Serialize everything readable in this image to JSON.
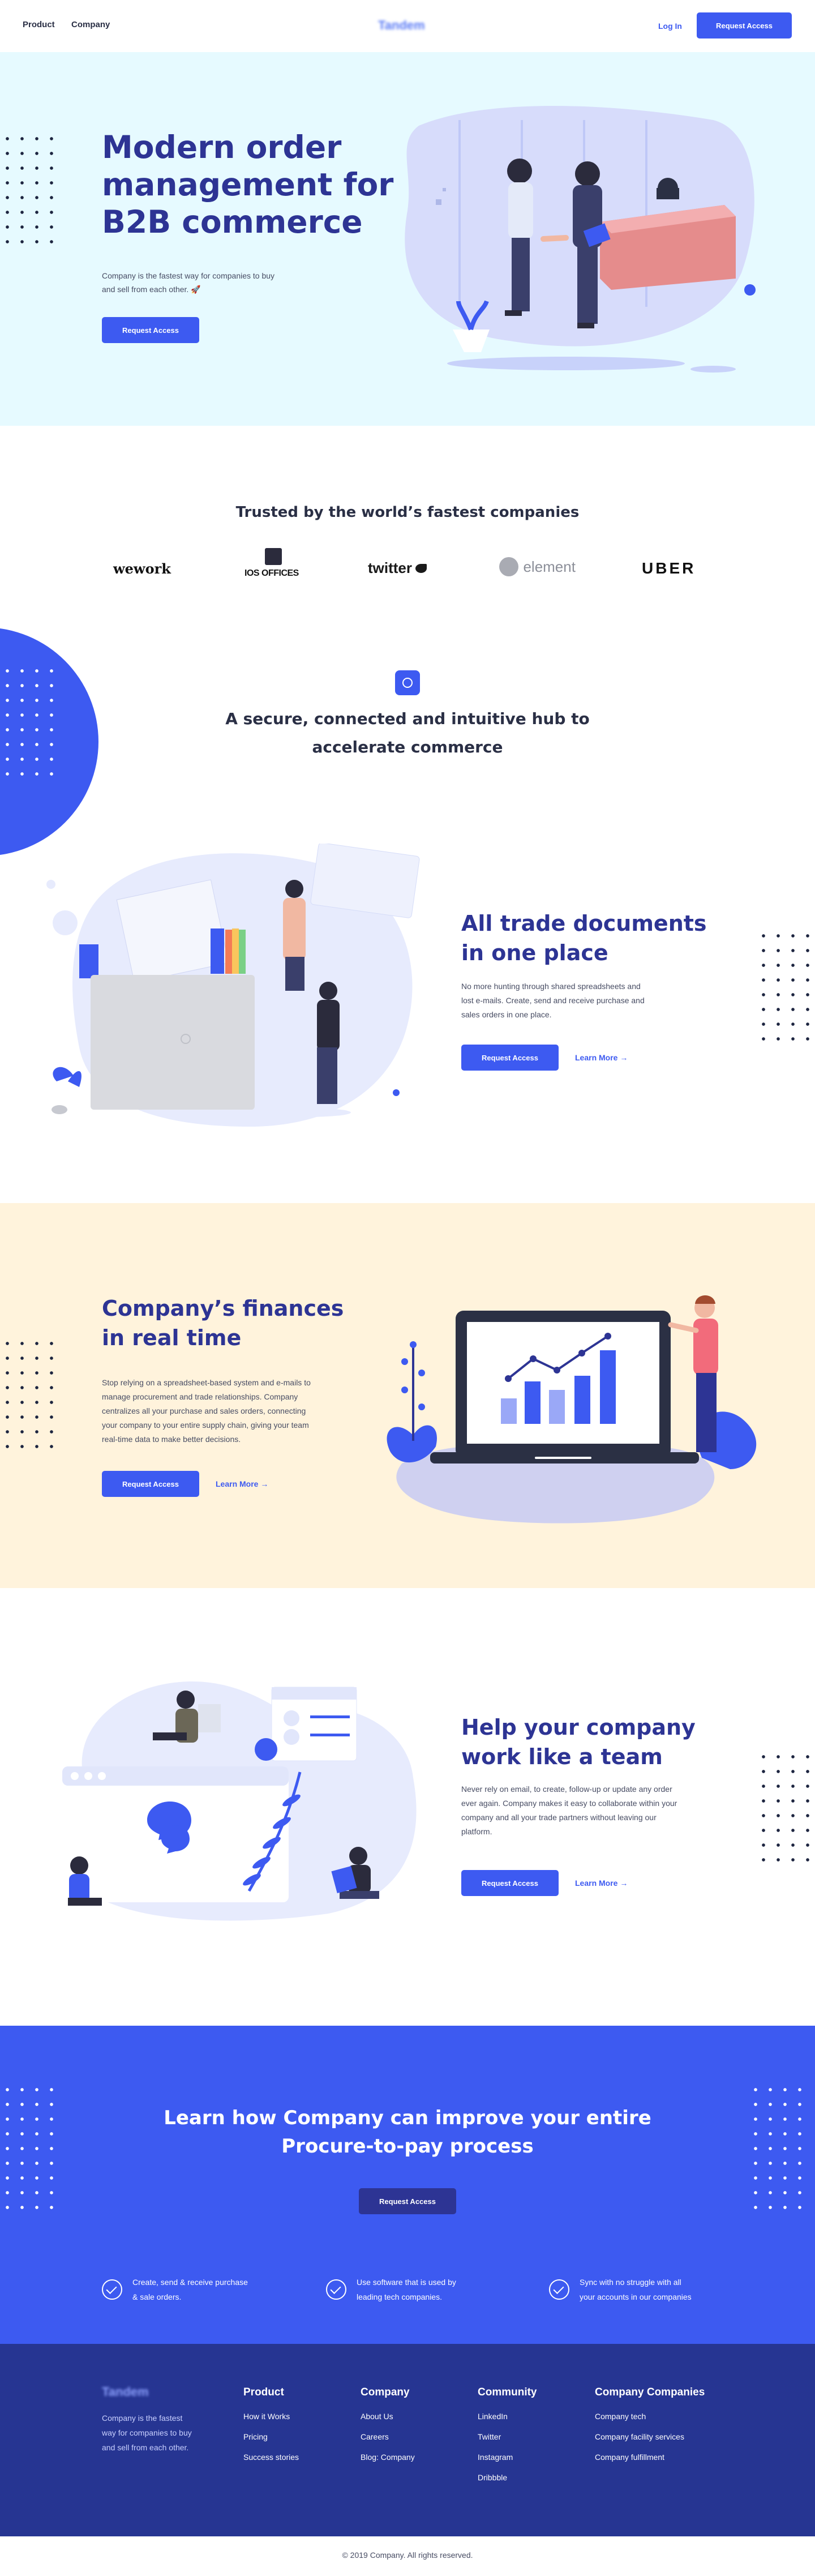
{
  "nav": {
    "items": [
      "Product",
      "Company"
    ],
    "logo": "Tandem",
    "login": "Log In",
    "cta": "Request Access"
  },
  "hero": {
    "title_line1": "Modern order",
    "title_line2": "management for",
    "title_line3": "B2B commerce",
    "subtitle_line1": "Company is the fastest way for companies to buy",
    "subtitle_line2": "and sell from each other. 🚀",
    "cta": "Request Access"
  },
  "trusted": {
    "title": "Trusted by the world’s fastest companies",
    "logos": [
      "wework",
      "IOS OFFICES",
      "twitter",
      "element",
      "UBER"
    ]
  },
  "hub": {
    "title_line1": "A secure, connected and intuitive hub to",
    "title_line2": "accelerate commerce"
  },
  "documents": {
    "title_line1": "All trade documents",
    "title_line2": "in one place",
    "body": [
      "No more hunting through shared spreadsheets and",
      "lost e-mails. Create, send and receive purchase and",
      "sales orders in one place."
    ],
    "cta": "Request Access",
    "link": "Learn More →"
  },
  "finances": {
    "title_line1": "Company’s finances",
    "title_line2": "in real time",
    "body": [
      "Stop relying on a spreadsheet-based system and e-mails to",
      "manage procurement and trade relationships. Company",
      "centralizes all your purchase and sales orders, connecting",
      "your company to your entire supply chain, giving your team",
      "real-time data to make better decisions."
    ],
    "cta": "Request Access",
    "link": "Learn More →"
  },
  "team": {
    "title_line1": "Help your company",
    "title_line2": "work like a team",
    "body": [
      "Never rely on email, to create, follow-up or update any order",
      "ever again. Company makes it easy to collaborate within your",
      "company and all your trade partners without leaving our",
      "platform."
    ],
    "cta": "Request Access",
    "link": "Learn More →"
  },
  "cta_band": {
    "title_line1": "Learn how Company can improve your entire",
    "title_line2": "Procure-to-pay process",
    "cta": "Request Access",
    "benefits": [
      {
        "line1": "Create, send & receive purchase",
        "line2": "& sale orders."
      },
      {
        "line1": "Use software that is used by",
        "line2": "leading tech companies."
      },
      {
        "line1": "Sync with no struggle with all",
        "line2": "your accounts in our companies"
      }
    ]
  },
  "footer": {
    "logo": "Tandem",
    "about": [
      "Company is the fastest",
      "way for companies to buy",
      "and sell from each other."
    ],
    "columns": [
      {
        "title": "Product",
        "links": [
          "How it Works",
          "Pricing",
          "Success stories"
        ]
      },
      {
        "title": "Company",
        "links": [
          "About Us",
          "Careers",
          "Blog: Company"
        ]
      },
      {
        "title": "Community",
        "links": [
          "LinkedIn",
          "Twitter",
          "Instagram",
          "Dribbble"
        ]
      },
      {
        "title": "Company Companies",
        "links": [
          "Company tech",
          "Company facility services",
          "Company fulfillment"
        ]
      }
    ],
    "copyright": "© 2019 Company. All rights reserved."
  },
  "colors": {
    "primary": "#3d5af1",
    "navy": "#2d3494",
    "hero_bg": "#e6faff",
    "finance_bg": "#fff3dc",
    "footer_bg": "#263592"
  }
}
